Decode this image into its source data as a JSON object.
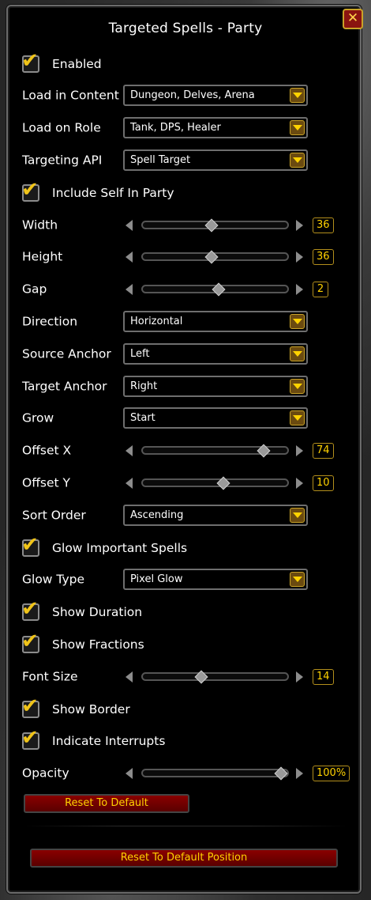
{
  "window": {
    "title": "Targeted Spells - Party",
    "close_glyph": "✕"
  },
  "check_glyph": "✔",
  "rows": [
    {
      "kind": "checkbox",
      "label": "Enabled",
      "checked": true
    },
    {
      "kind": "dropdown",
      "label": "Load in Content",
      "value": "Dungeon, Delves, Arena"
    },
    {
      "kind": "dropdown",
      "label": "Load on Role",
      "value": "Tank, DPS, Healer"
    },
    {
      "kind": "dropdown",
      "label": "Targeting API",
      "value": "Spell Target"
    },
    {
      "kind": "checkbox",
      "label": "Include Self In Party",
      "checked": true
    },
    {
      "kind": "slider",
      "label": "Width",
      "value": "36",
      "fraction": 0.48
    },
    {
      "kind": "slider",
      "label": "Height",
      "value": "36",
      "fraction": 0.48
    },
    {
      "kind": "slider",
      "label": "Gap",
      "value": "2",
      "fraction": 0.53
    },
    {
      "kind": "dropdown",
      "label": "Direction",
      "value": "Horizontal"
    },
    {
      "kind": "dropdown",
      "label": "Source Anchor",
      "value": "Left"
    },
    {
      "kind": "dropdown",
      "label": "Target Anchor",
      "value": "Right"
    },
    {
      "kind": "dropdown",
      "label": "Grow",
      "value": "Start"
    },
    {
      "kind": "slider",
      "label": "Offset X",
      "value": "74",
      "fraction": 0.87
    },
    {
      "kind": "slider",
      "label": "Offset Y",
      "value": "10",
      "fraction": 0.57
    },
    {
      "kind": "dropdown",
      "label": "Sort Order",
      "value": "Ascending"
    },
    {
      "kind": "checkbox",
      "label": "Glow Important Spells",
      "checked": true
    },
    {
      "kind": "dropdown",
      "label": "Glow Type",
      "value": "Pixel Glow"
    },
    {
      "kind": "checkbox",
      "label": "Show Duration",
      "checked": true
    },
    {
      "kind": "checkbox",
      "label": "Show Fractions",
      "checked": true
    },
    {
      "kind": "slider",
      "label": "Font Size",
      "value": "14",
      "fraction": 0.4
    },
    {
      "kind": "checkbox",
      "label": "Show Border",
      "checked": true
    },
    {
      "kind": "checkbox",
      "label": "Indicate Interrupts",
      "checked": true
    },
    {
      "kind": "slider",
      "label": "Opacity",
      "value": "100%",
      "fraction": 1.0
    }
  ],
  "buttons": {
    "reset_default": "Reset To Default",
    "reset_position": "Reset To Default Position"
  },
  "colors": {
    "accent": "#ffd200",
    "check": "#f0c419",
    "button_red": "#8a0000",
    "close_red": "#8a1410"
  }
}
